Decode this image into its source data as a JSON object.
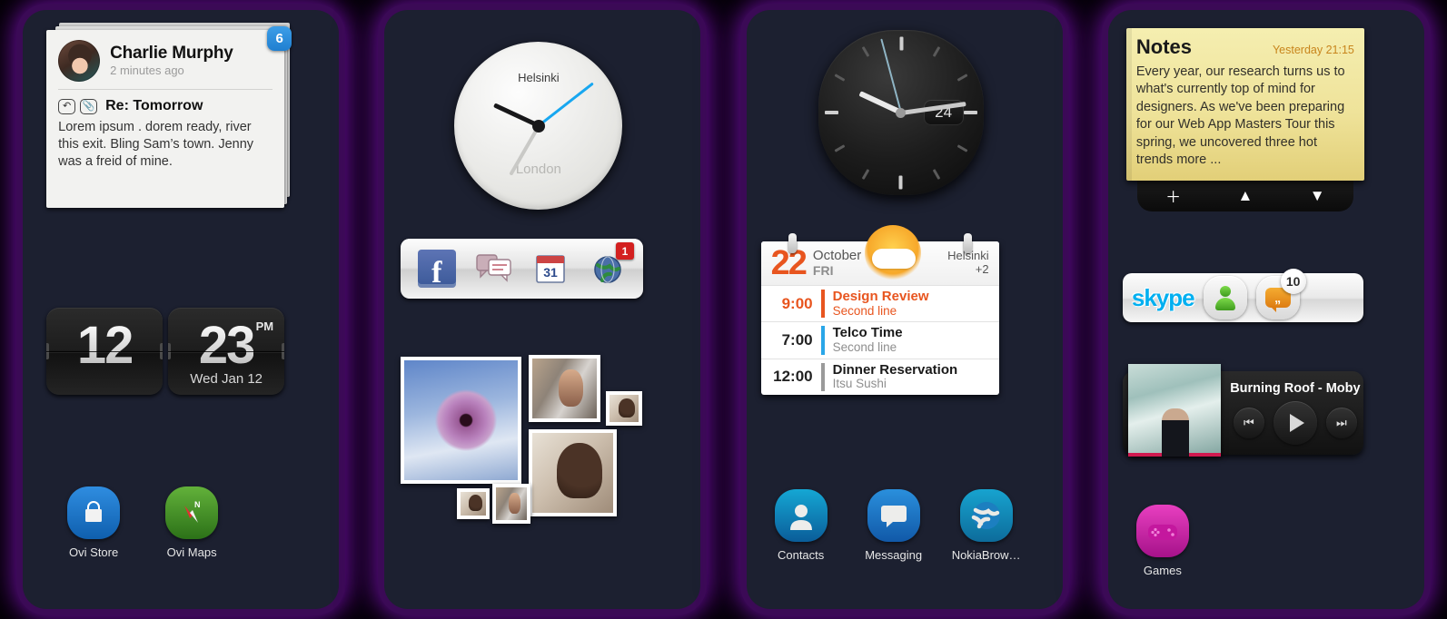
{
  "panel1": {
    "email": {
      "sender": "Charlie Murphy",
      "time": "2 minutes ago",
      "badge": "6",
      "subject": "Re: Tomorrow",
      "body": "Lorem ipsum . dorem ready, river this exit. Bling Sam’s town. Jenny was a freid of mine.",
      "reply_icon": "reply-arrow-icon",
      "attach_icon": "paperclip-icon",
      "action_reply": "↶",
      "action_add": "＋",
      "action_delete": "🗑"
    },
    "clock": {
      "hours": "12",
      "minutes": "23",
      "ampm": "PM",
      "date": "Wed Jan 12"
    },
    "apps": [
      {
        "label": "Ovi Store",
        "icon": "shopping-bag-icon",
        "color": "#1669c8"
      },
      {
        "label": "Ovi Maps",
        "icon": "compass-icon",
        "color": "#3f8a24"
      }
    ]
  },
  "panel2": {
    "clock": {
      "city_primary": "Helsinki",
      "city_secondary": "London",
      "hour_deg": 205,
      "minute_deg": 120,
      "second_deg": -38
    },
    "shortcuts": [
      {
        "name": "facebook-icon",
        "label": "f",
        "badge": ""
      },
      {
        "name": "messaging-icon",
        "label": "",
        "badge": ""
      },
      {
        "name": "calendar-icon",
        "label": "31",
        "badge": ""
      },
      {
        "name": "browser-globe-icon",
        "label": "",
        "badge": "1"
      }
    ],
    "gallery": {
      "photos": [
        {
          "name": "photo-flower",
          "kind": "flower"
        },
        {
          "name": "photo-man-scarf",
          "kind": "man"
        },
        {
          "name": "photo-woman-small",
          "kind": "woman"
        },
        {
          "name": "photo-woman-large",
          "kind": "woman"
        },
        {
          "name": "photo-woman-tiny",
          "kind": "woman"
        },
        {
          "name": "photo-man-tiny",
          "kind": "man"
        }
      ]
    }
  },
  "panel3": {
    "clock": {
      "date": "24",
      "hour_deg": 205,
      "minute_deg": 76,
      "second_deg": -28
    },
    "calendar": {
      "day": "22",
      "month": "October",
      "weekday": "FRI",
      "city": "Helsinki",
      "temp": "+2",
      "weather_icon": "sun-behind-cloud-icon",
      "events": [
        {
          "time": "9:00",
          "title": "Design Review",
          "sub": "Second line",
          "color": "#e8551f",
          "accent": true
        },
        {
          "time": "7:00",
          "title": "Telco Time",
          "sub": "Second line",
          "color": "#29a6e8",
          "accent": false
        },
        {
          "time": "12:00",
          "title": "Dinner Reservation",
          "sub": "Itsu Sushi",
          "color": "#9a9a9a",
          "accent": false
        }
      ]
    },
    "apps": [
      {
        "label": "Contacts",
        "icon": "person-icon",
        "color": "#0b83b8"
      },
      {
        "label": "Messaging",
        "icon": "speech-bubble-icon",
        "color": "#1c74c4"
      },
      {
        "label": "NokiaBrow…",
        "icon": "globe-icon",
        "color": "#1390b8"
      }
    ]
  },
  "panel4": {
    "notes": {
      "title": "Notes",
      "timestamp": "Yesterday 21:15",
      "body": "Every year, our research turns us to what's currently top of mind for designers. As we've been preparing for our Web App Masters Tour this spring, we uncovered three hot trends more   ...",
      "action_add": "＋",
      "action_up": "▲",
      "action_down": "▼"
    },
    "skype": {
      "logo": "skype",
      "contacts_icon": "person-green-icon",
      "chat_icon": "chat-bubble-orange-icon",
      "badge": "10"
    },
    "player": {
      "track": "Burning Roof - Moby",
      "prev_icon": "⏮",
      "play_icon": "play-triangle-icon",
      "next_icon": "⏭"
    },
    "apps": [
      {
        "label": "Games",
        "icon": "gamepad-folder-icon",
        "color": "#d21fa0"
      }
    ]
  }
}
